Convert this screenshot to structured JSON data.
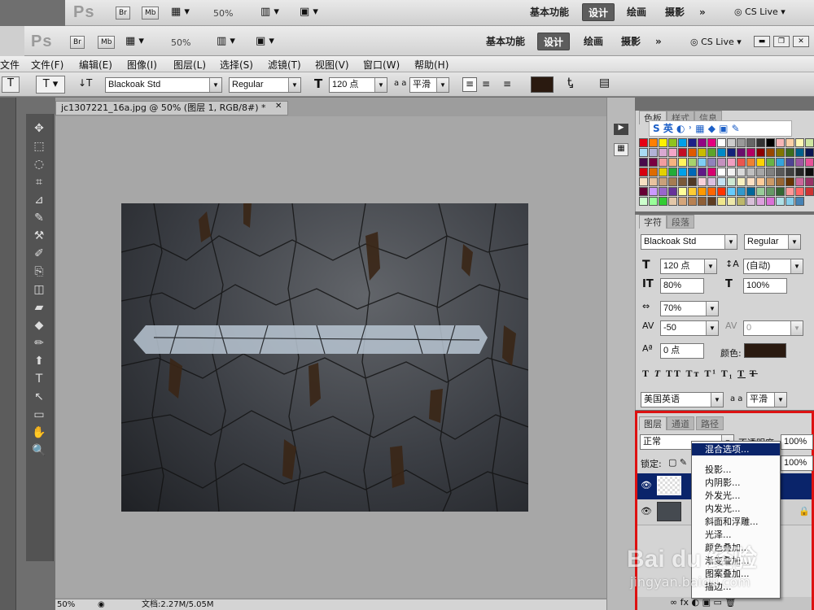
{
  "app": {
    "logo": "Ps",
    "br": "Br",
    "mb": "Mb",
    "zoom": "50%",
    "zoom_status": "50%"
  },
  "workspace": {
    "basic": "基本功能",
    "design": "设计",
    "paint": "绘画",
    "photo": "摄影",
    "more": "»",
    "cslive": "CS Live"
  },
  "menu": [
    "文件(F)",
    "编辑(E)",
    "图像(I)",
    "图层(L)",
    "选择(S)",
    "滤镜(T)",
    "视图(V)",
    "窗口(W)",
    "帮助(H)"
  ],
  "background_menu_fragment": "文件",
  "options": {
    "font_family": "Blackoak Std",
    "font_style": "Regular",
    "font_size": "120 点",
    "aa_label": "a a",
    "antialias": "平滑",
    "text_color": "#2a1a10"
  },
  "document": {
    "tab_title": "jc1307221_16a.jpg @ 50% (图层 1, RGB/8#) *",
    "status": "文档:2.27M/5.05M"
  },
  "swatches_panel": {
    "tabs": [
      "色板",
      "样式",
      "信息"
    ],
    "ime_bar": "S 英",
    "colors": [
      "#e60012",
      "#ff7f00",
      "#fff100",
      "#8fc31f",
      "#00a0e9",
      "#1d2088",
      "#920783",
      "#e4007f",
      "#ffffff",
      "#cccccc",
      "#999999",
      "#666666",
      "#333333",
      "#000000",
      "#f7b6b6",
      "#fbd0a6",
      "#fff8b3",
      "#cde6a1",
      "#a8dcf5",
      "#b2b3d7",
      "#d8a8d2",
      "#f5a6c8",
      "#c30d23",
      "#e05a00",
      "#c9bc00",
      "#5ca42a",
      "#0089c7",
      "#13227a",
      "#6a0f6c",
      "#b50062",
      "#8d0000",
      "#984800",
      "#817600",
      "#3d6d1d",
      "#00608c",
      "#0a1551",
      "#470b4b",
      "#7b0041",
      "#f29c9f",
      "#f6b37f",
      "#fff45c",
      "#a6d26c",
      "#7ecef4",
      "#8f82bc",
      "#c490bf",
      "#f19ec2",
      "#ea5550",
      "#ee8131",
      "#fcd302",
      "#68b345",
      "#34a3dc",
      "#4e4393",
      "#9d56a2",
      "#e85298",
      "#d7000f",
      "#de6b00",
      "#e3d100",
      "#22ac38",
      "#00a1e9",
      "#0068b7",
      "#601986",
      "#d6006f",
      "#ffffff",
      "#f2f2f2",
      "#d9d9d9",
      "#bfbfbf",
      "#a6a6a6",
      "#808080",
      "#595959",
      "#404040",
      "#262626",
      "#0d0d0d",
      "#f8e1c3",
      "#e8c39e",
      "#c9a07a",
      "#a67c52",
      "#7a5a3a",
      "#4f3825",
      "#f9d2dc",
      "#dcc1e2",
      "#c4e3f2",
      "#cfe9d2",
      "#f9f1c0",
      "#fde1c4",
      "#ffcc99",
      "#cc9966",
      "#996633",
      "#663300",
      "#cc6699",
      "#993366",
      "#660033",
      "#cc99ff",
      "#9966cc",
      "#663399",
      "#ffff99",
      "#ffcc33",
      "#ff9900",
      "#ff6600",
      "#ff3300",
      "#66ccff",
      "#3399cc",
      "#006699",
      "#99cc99",
      "#669966",
      "#336633",
      "#ff9999",
      "#ff6666",
      "#cc3333",
      "#ccffcc",
      "#99ff99",
      "#33cc33",
      "#e3c7a8",
      "#d4a57a",
      "#b88152",
      "#8f5f37",
      "#5e3d22",
      "#f0e68c",
      "#eee8aa",
      "#bdb76b",
      "#d8bfd8",
      "#dda0dd",
      "#da70d6",
      "#b0e0e6",
      "#87ceeb",
      "#4682b4"
    ]
  },
  "character_panel": {
    "tabs": [
      "字符",
      "段落"
    ],
    "font_family": "Blackoak Std",
    "font_style": "Regular",
    "size": "120 点",
    "leading": "(自动)",
    "vscale": "80%",
    "hscale": "100%",
    "tsume": "70%",
    "tracking": "-50",
    "kerning": "0",
    "baseline": "0 点",
    "color_label": "颜色:",
    "color": "#2a1a10",
    "language": "美国英语",
    "aa_label": "a a",
    "antialias": "平滑"
  },
  "layers_panel": {
    "tabs": [
      "图层",
      "通道",
      "路径"
    ],
    "blend_mode": "正常",
    "opacity_label": "不透明度:",
    "opacity": "100%",
    "lock_label": "锁定:",
    "fill": "100%"
  },
  "context_menu": {
    "items": [
      "混合选项...",
      "投影...",
      "内阴影...",
      "外发光...",
      "内发光...",
      "斜面和浮雕...",
      "光泽...",
      "颜色叠加...",
      "渐变叠加...",
      "图案叠加...",
      "描边..."
    ]
  },
  "watermark": {
    "logo": "Bai du 经验",
    "url": "jingyan.baidu.com"
  }
}
